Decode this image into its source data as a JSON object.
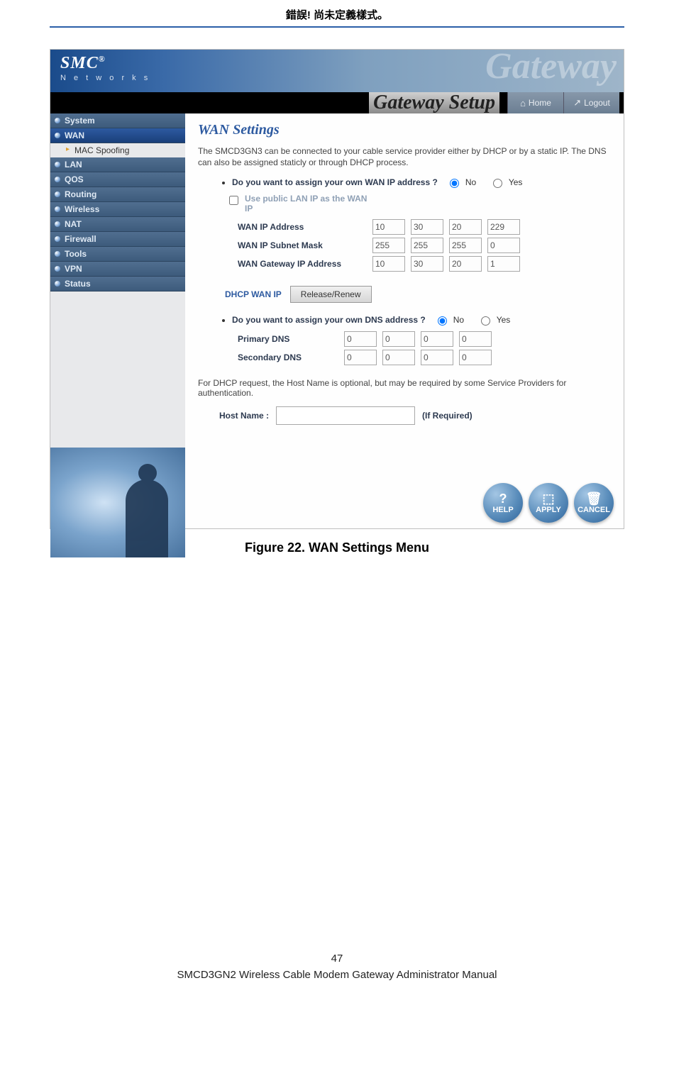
{
  "doc": {
    "heading": "錯誤! 尚未定義樣式。",
    "caption": "Figure 22. WAN Settings Menu",
    "page_number": "47",
    "footer": "SMCD3GN2 Wireless Cable Modem Gateway Administrator Manual"
  },
  "banner": {
    "logo": "SMC",
    "logo_reg": "®",
    "logo_sub": "N e t w o r k s",
    "ghost": "Gateway"
  },
  "header": {
    "title": "Gateway Setup",
    "home": "Home",
    "logout": "Logout"
  },
  "sidebar": {
    "items": [
      {
        "label": "System"
      },
      {
        "label": "WAN",
        "active": true
      },
      {
        "label": "LAN"
      },
      {
        "label": "QOS"
      },
      {
        "label": "Routing"
      },
      {
        "label": "Wireless"
      },
      {
        "label": "NAT"
      },
      {
        "label": "Firewall"
      },
      {
        "label": "Tools"
      },
      {
        "label": "VPN"
      },
      {
        "label": "Status"
      }
    ],
    "sub": "MAC Spoofing"
  },
  "content": {
    "title": "WAN Settings",
    "desc": "The SMCD3GN3 can be connected to your cable service provider either by DHCP or by a static IP. The DNS can also be assigned staticly or through DHCP process.",
    "q_wan": "Do you want to assign your own WAN IP address ?",
    "no": "No",
    "yes": "Yes",
    "use_public": "Use public LAN IP as the WAN IP",
    "wan_ip_lbl": "WAN IP Address",
    "wan_ip": [
      "10",
      "30",
      "20",
      "229"
    ],
    "wan_mask_lbl": "WAN IP Subnet Mask",
    "wan_mask": [
      "255",
      "255",
      "255",
      "0"
    ],
    "wan_gw_lbl": "WAN Gateway IP Address",
    "wan_gw": [
      "10",
      "30",
      "20",
      "1"
    ],
    "dhcp_lbl": "DHCP WAN IP",
    "dhcp_btn": "Release/Renew",
    "q_dns": "Do you want to assign your own DNS address ?",
    "pdns_lbl": "Primary DNS",
    "pdns": [
      "0",
      "0",
      "0",
      "0"
    ],
    "sdns_lbl": "Secondary DNS",
    "sdns": [
      "0",
      "0",
      "0",
      "0"
    ],
    "note": "For DHCP request, the Host Name is optional, but may be required by some Service Providers for authentication.",
    "host_lbl": "Host Name :",
    "host_req": "(If Required)",
    "help": "HELP",
    "apply": "APPLY",
    "cancel": "CANCEL"
  }
}
